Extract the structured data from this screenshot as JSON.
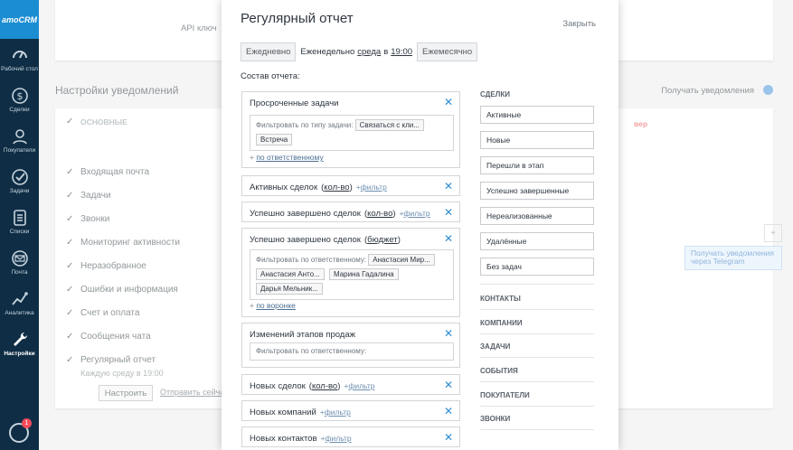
{
  "nav": {
    "logo": "amoCRM",
    "items": [
      {
        "label": "Рабочий стол",
        "icon": "speedometer-icon"
      },
      {
        "label": "Сделки",
        "icon": "dollar-icon"
      },
      {
        "label": "Покупатели",
        "icon": "customers-icon"
      },
      {
        "label": "Задачи",
        "icon": "checkmark-icon"
      },
      {
        "label": "Списки",
        "icon": "list-icon"
      },
      {
        "label": "Почта",
        "icon": "mail-icon"
      },
      {
        "label": "Аналитика",
        "icon": "analytics-icon"
      },
      {
        "label": "Настройки",
        "icon": "wrench-icon"
      }
    ],
    "chat_badge": "1"
  },
  "background": {
    "api_label": "API ключ",
    "section_title": "Настройки уведомлений",
    "receive_label": "Получать уведомления",
    "header": "Основные",
    "red_header": "вер",
    "rows": [
      "Входящая почта",
      "Задачи",
      "Звонки",
      "Мониторинг активности",
      "Неразобранное",
      "Ошибки и информация",
      "Счет и оплата",
      "Сообщения чата",
      "Регулярный отчет"
    ],
    "report_sub": "Каждую среду в 19:00",
    "setup_button": "Настроить",
    "send_now": "Отправить сейчас",
    "telegram": "Получать уведомления через Telegram"
  },
  "modal": {
    "title": "Регулярный отчет",
    "close": "Закрыть",
    "freq": {
      "daily": "Ежедневно",
      "weekly": "Еженедельно",
      "day": "среда",
      "in": "в",
      "time": "19:00",
      "monthly": "Ежемесячно"
    },
    "composition": "Состав отчета:",
    "blocks": {
      "b1": {
        "title": "Просроченные задачи",
        "filter_label": "Фильтровать по типу задачи:",
        "chips": [
          "Связаться с кли...",
          "Встреча"
        ],
        "add": "по ответственному"
      },
      "b2": {
        "title": "Активных сделок",
        "paren": "кол-во",
        "filter": "фильтр"
      },
      "b3": {
        "title": "Успешно завершено сделок",
        "paren": "кол-во",
        "filter": "фильтр"
      },
      "b4": {
        "title": "Успешно завершено сделок",
        "paren": "бюджет",
        "filter_label": "Фильтровать по ответственному:",
        "chips": [
          "Анастасия Мир...",
          "Анастасия Анто...",
          "Марина Гадалина",
          "Дарья Мельник..."
        ],
        "add": "по воронке"
      },
      "b5": {
        "title": "Изменений этапов продаж",
        "filter_label": "Фильтровать по ответственному:"
      },
      "b6": {
        "title": "Новых сделок",
        "paren": "кол-во",
        "filter": "фильтр"
      },
      "b7": {
        "title": "Новых компаний",
        "filter": "фильтр"
      },
      "b8": {
        "title": "Новых контактов",
        "filter": "фильтр"
      }
    },
    "right": {
      "deals_title": "СДЕЛКИ",
      "deals": [
        "Активные",
        "Новые",
        "Перешли в этап",
        "Успешно завершенные",
        "Нереализованные",
        "Удалённые",
        "Без задач"
      ],
      "sections": [
        "КОНТАКТЫ",
        "КОМПАНИИ",
        "ЗАДАЧИ",
        "СОБЫТИЯ",
        "ПОКУПАТЕЛИ",
        "ЗВОНКИ"
      ]
    }
  }
}
